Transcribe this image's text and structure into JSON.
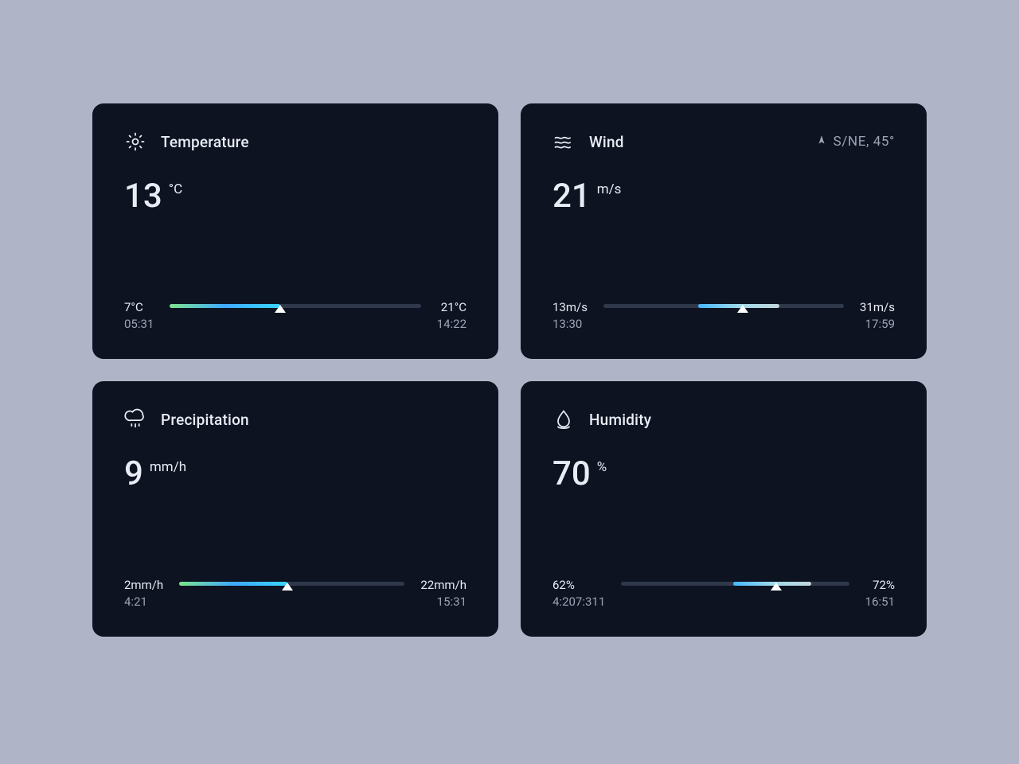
{
  "cards": [
    {
      "id": "temperature",
      "title": "Temperature",
      "value": "13",
      "unit": "°C",
      "min_value": "7°C",
      "min_time": "05:31",
      "max_value": "21°C",
      "max_time": "14:22",
      "percent": 44,
      "fill_style": "warm",
      "extra": null
    },
    {
      "id": "wind",
      "title": "Wind",
      "value": "21",
      "unit": "m/s",
      "min_value": "13m/s",
      "min_time": "13:30",
      "max_value": "31m/s",
      "max_time": "17:59",
      "percent": 58,
      "fill_style": "cold",
      "extra": {
        "label": "S/NE, 45°"
      }
    },
    {
      "id": "precipitation",
      "title": "Precipitation",
      "value": "9",
      "unit": "mm/h",
      "min_value": "2mm/h",
      "min_time": "4:21",
      "max_value": "22mm/h",
      "max_time": "15:31",
      "percent": 48,
      "fill_style": "warm",
      "extra": null
    },
    {
      "id": "humidity",
      "title": "Humidity",
      "value": "70",
      "unit": "%",
      "min_value": "62%",
      "min_time": "4:207:311",
      "max_value": "72%",
      "max_time": "16:51",
      "percent": 68,
      "fill_style": "cold",
      "extra": null
    }
  ]
}
